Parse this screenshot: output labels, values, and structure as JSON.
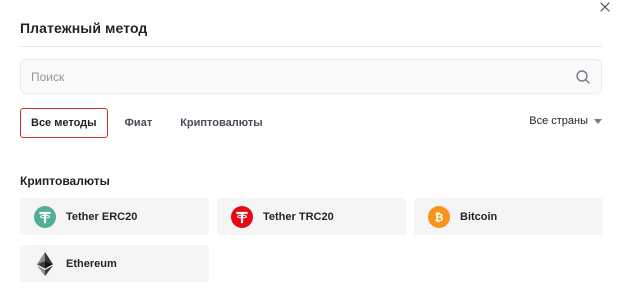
{
  "modal": {
    "title": "Платежный метод"
  },
  "search": {
    "placeholder": "Поиск",
    "value": ""
  },
  "tabs": [
    {
      "label": "Все методы",
      "active": true
    },
    {
      "label": "Фиат",
      "active": false
    },
    {
      "label": "Криптовалюты",
      "active": false
    }
  ],
  "country_filter": {
    "label": "Все страны"
  },
  "section": {
    "title": "Криптовалюты"
  },
  "methods": [
    {
      "label": "Tether ERC20",
      "icon": "tether-erc20-icon",
      "color": "#50af95"
    },
    {
      "label": "Tether TRC20",
      "icon": "tether-trc20-icon",
      "color": "#e50914"
    },
    {
      "label": "Bitcoin",
      "icon": "bitcoin-icon",
      "color": "#f7931a"
    },
    {
      "label": "Ethereum",
      "icon": "ethereum-icon",
      "color": "#343434"
    }
  ],
  "colors": {
    "active_tab_border": "#d32f2f",
    "card_background": "#f5f5f6"
  }
}
